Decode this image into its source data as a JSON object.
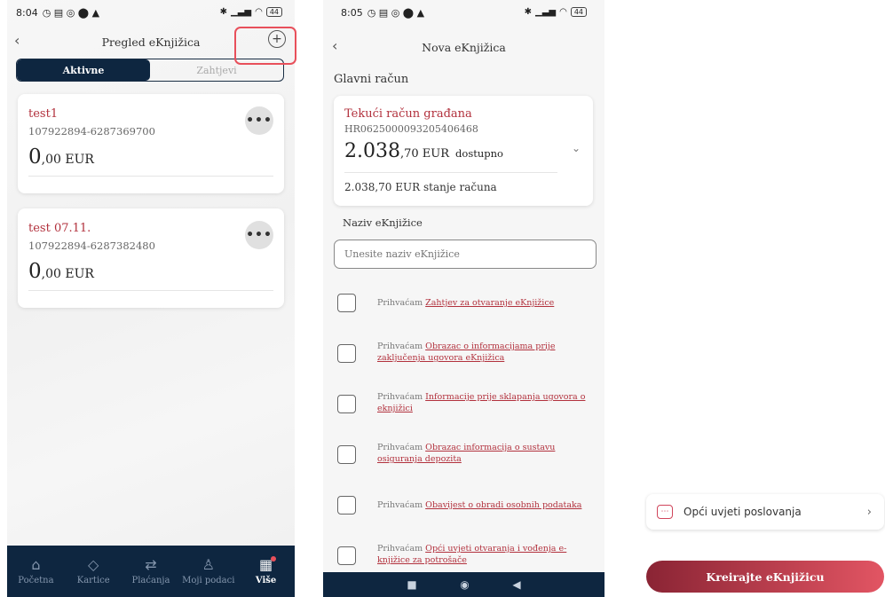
{
  "screen1": {
    "status": {
      "time": "8:04",
      "battery": "44"
    },
    "title": "Pregled eKnjižica",
    "add_icon": "plus-circle-icon",
    "tabs": {
      "active": "Aktivne",
      "inactive": "Zahtjevi"
    },
    "cards": [
      {
        "name": "test1",
        "iban": "107922894-6287369700",
        "amount_int": "0",
        "amount_rest": ",00 EUR"
      },
      {
        "name": "test 07.11.",
        "iban": "107922894-6287382480",
        "amount_int": "0",
        "amount_rest": ",00 EUR"
      }
    ],
    "nav": [
      {
        "label": "Početna",
        "icon": "home-icon"
      },
      {
        "label": "Kartice",
        "icon": "card-icon"
      },
      {
        "label": "Plaćanja",
        "icon": "transfer-icon"
      },
      {
        "label": "Moji podaci",
        "icon": "user-icon"
      },
      {
        "label": "Više",
        "icon": "grid-icon"
      }
    ]
  },
  "screen2": {
    "status": {
      "time": "8:05",
      "battery": "44"
    },
    "title": "Nova eKnjižica",
    "section_title": "Glavni račun",
    "account": {
      "name": "Tekući račun građana",
      "iban": "HR0625000093205406468",
      "amount_int": "2.038",
      "amount_rest": ",70 EUR",
      "amount_suffix": "dostupno",
      "balance": "2.038,70 EUR stanje računa"
    },
    "name_label": "Naziv eKnjižice",
    "name_placeholder": "Unesite naziv eKnjižice",
    "consent_prefix": "Prihvaćam",
    "consents": [
      "Zahtjev za otvaranje eKnjižice",
      "Obrazac o informacijama prije zaključenja ugovora eKnjižica",
      "Informacije prije sklapanja ugovora o eknjižici",
      "Obrazac informacija o sustavu osiguranja depozita",
      "Obavijest o obradi osobnih podataka",
      "Opći uvjeti otvaranja i vođenja e-knjižice za potrošače"
    ]
  },
  "screen3": {
    "terms_label": "Opći uvjeti poslovanja",
    "create_label": "Kreirajte eKnjižicu"
  },
  "colors": {
    "navy": "#0e2640",
    "accent": "#b2313d",
    "highlight": "#e8505b"
  }
}
